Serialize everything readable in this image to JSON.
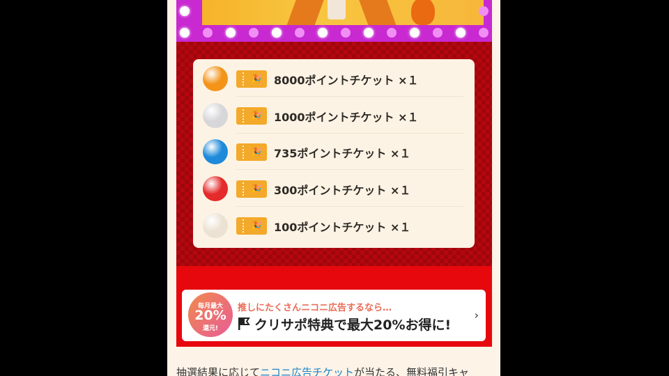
{
  "prizes": [
    {
      "label": "8000ポイントチケット ×１",
      "ball_color": "#f39419"
    },
    {
      "label": "1000ポイントチケット ×１",
      "ball_color": "#d7d7d9"
    },
    {
      "label": "735ポイントチケット ×１",
      "ball_color": "#1e8ad9"
    },
    {
      "label": "300ポイントチケット ×１",
      "ball_color": "#e42a2a"
    },
    {
      "label": "100ポイントチケット ×１",
      "ball_color": "#ece2d4"
    }
  ],
  "banner": {
    "badge_line1": "毎月最大",
    "badge_line2": "20%",
    "badge_line3": "還元!",
    "subtitle": "推しにたくさんニコニ広告するなら…",
    "title": "クリサポ特典で最大20%お得に!"
  },
  "paragraph": {
    "before": "抽選結果に応じて",
    "link": "ニコニ広告チケット",
    "after": "が当たる、無料福引キャ"
  },
  "colors": {
    "frame": "#c829d1",
    "board": "#b5070f",
    "strip": "#e6080d",
    "ticket": "#f3a929",
    "link": "#1a84c7"
  }
}
